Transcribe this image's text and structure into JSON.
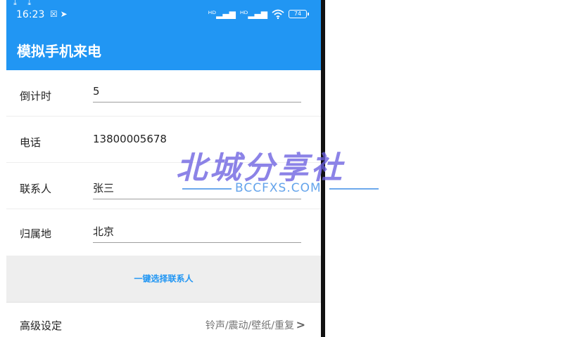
{
  "status_bar": {
    "download_icons": "⤓ ⤓",
    "time": "16:23",
    "indicators": "☒ ➤",
    "signal_1": "ᴴᴰ▂▄▆",
    "signal_2": "ᴴᴰ▂▄▆",
    "wifi": "wifi-icon",
    "battery_level": "74"
  },
  "app": {
    "title": "模拟手机来电"
  },
  "form": {
    "countdown": {
      "label": "倒计时",
      "value": "5"
    },
    "phone": {
      "label": "电话",
      "value": "13800005678"
    },
    "contact": {
      "label": "联系人",
      "value": "张三"
    },
    "location": {
      "label": "归属地",
      "value": "北京"
    }
  },
  "pick_contact_button": "一键选择联系人",
  "advanced": {
    "label": "高级设定",
    "value": "铃声/震动/壁纸/重复"
  },
  "watermark": {
    "title": "北城分享社",
    "subtitle": "BCCFXS.COM"
  },
  "colors": {
    "accent": "#2196f3",
    "divider": "#eeeeee",
    "button_area": "#eeeeee"
  }
}
